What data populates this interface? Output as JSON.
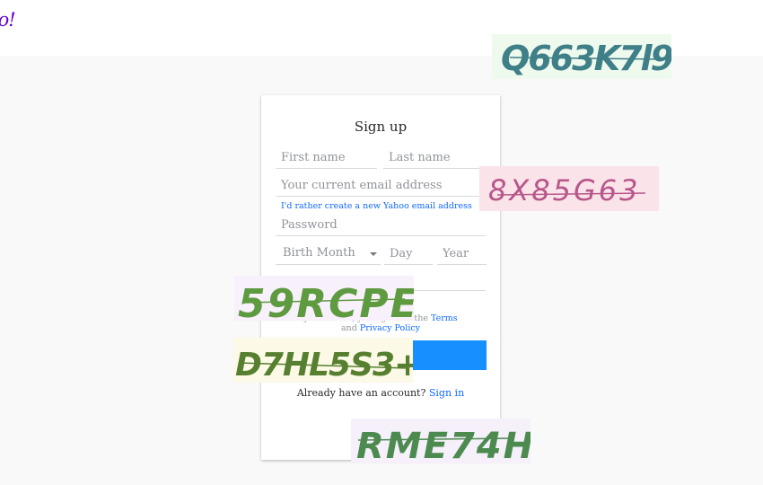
{
  "header": {
    "logo": "oo!"
  },
  "form": {
    "title": "Sign up",
    "first_name_placeholder": "First name",
    "last_name_placeholder": "Last name",
    "email_placeholder": "Your current email address",
    "create_yahoo_link": "I'd rather create a new Yahoo email address",
    "password_placeholder": "Password",
    "birth_month_label": "Birth Month",
    "day_placeholder": "Day",
    "year_placeholder": "Year",
    "terms_prefix": "y ....... ...... , you agree to the",
    "terms_link": "Terms",
    "terms_and": "and",
    "privacy_link": "Privacy Policy",
    "signin_prompt": "Already have an account?",
    "signin_link": "Sign in"
  },
  "captchas": [
    {
      "text": "Q663K7l9",
      "bg": "#eefaee",
      "ink": "#3f7f88"
    },
    {
      "text": "8X85G63",
      "bg": "#fbe3ea",
      "ink": "#b7578a"
    },
    {
      "text": "59RCPE",
      "bg": "#f8f0fa",
      "ink": "#5e9a40"
    },
    {
      "text": "D7HL5S3+",
      "bg": "#fcf9e6",
      "ink": "#567f30"
    },
    {
      "text": "RME74H",
      "bg": "#f6f0fa",
      "ink": "#4c8a50"
    }
  ],
  "colors": {
    "accent": "#188fff",
    "link": "#0f69ff",
    "brand": "#5f01d1"
  }
}
